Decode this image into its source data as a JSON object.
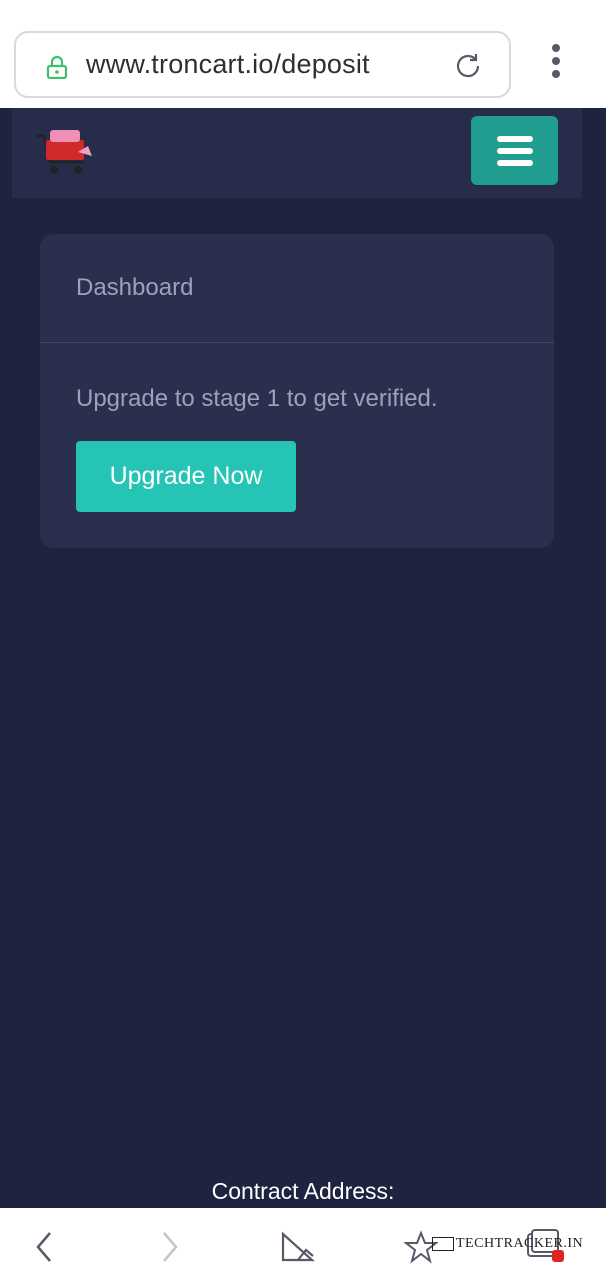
{
  "browser": {
    "url": "www.troncart.io/deposit",
    "lock_icon": "lock-icon",
    "reload_icon": "reload-icon",
    "menu_icon": "kebab-menu-icon"
  },
  "header": {
    "logo_icon": "shopping-cart-logo",
    "menu_icon": "hamburger-icon"
  },
  "card": {
    "title": "Dashboard",
    "message": "Upgrade to stage 1 to get verified.",
    "button_label": "Upgrade Now"
  },
  "footer": {
    "contract_label": "Contract Address:"
  },
  "bottom_nav": {
    "items": [
      "back-icon",
      "forward-icon",
      "shortcut-icon",
      "bookmark-star-icon",
      "tabs-icon"
    ]
  },
  "watermark": {
    "text": "TECHTRACKER.IN"
  },
  "colors": {
    "page_bg": "#1e2340",
    "card_bg": "#2a2f4e",
    "accent": "#25c4b4",
    "menu_button": "#1f9e90"
  }
}
